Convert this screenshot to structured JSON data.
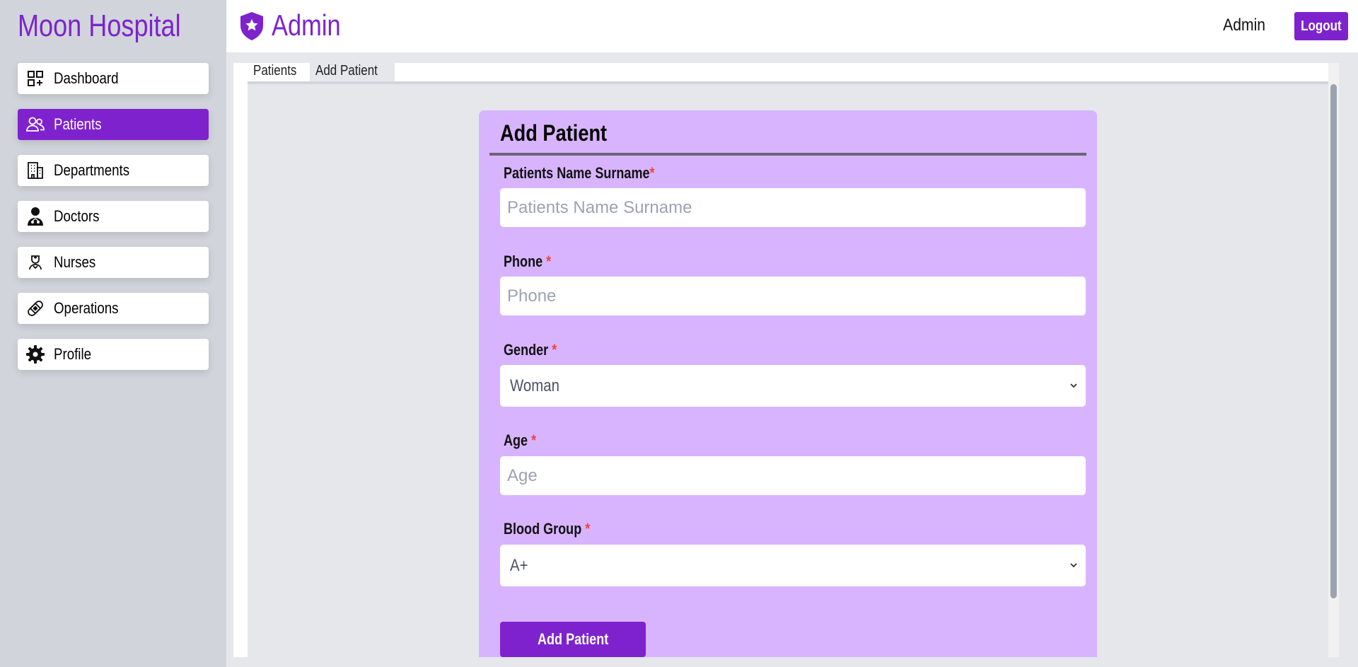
{
  "brand": "Moon Hospital",
  "header": {
    "title": "Admin",
    "user": "Admin",
    "logout_label": "Logout"
  },
  "sidebar": {
    "items": [
      {
        "label": "Dashboard",
        "icon": "dashboard-icon",
        "active": false
      },
      {
        "label": "Patients",
        "icon": "patients-icon",
        "active": true
      },
      {
        "label": "Departments",
        "icon": "building-icon",
        "active": false
      },
      {
        "label": "Doctors",
        "icon": "doctor-icon",
        "active": false
      },
      {
        "label": "Nurses",
        "icon": "nurse-icon",
        "active": false
      },
      {
        "label": "Operations",
        "icon": "bandage-icon",
        "active": false
      },
      {
        "label": "Profile",
        "icon": "gear-icon",
        "active": false
      }
    ]
  },
  "tabs": [
    {
      "label": "Patients",
      "active": false
    },
    {
      "label": "Add Patient",
      "active": true
    }
  ],
  "form": {
    "title": "Add Patient",
    "required_mark": "*",
    "fields": {
      "name": {
        "label": "Patients Name Surname",
        "placeholder": "Patients Name Surname"
      },
      "phone": {
        "label": "Phone",
        "placeholder": "Phone"
      },
      "gender": {
        "label": "Gender",
        "value": "Woman"
      },
      "age": {
        "label": "Age",
        "placeholder": "Age"
      },
      "blood": {
        "label": "Blood Group",
        "value": "A+"
      }
    },
    "submit_label": "Add Patient"
  },
  "colors": {
    "accent": "#7e22ce",
    "card": "#d8b4fe",
    "required": "#ef4444",
    "sidebar_bg": "#d1d5db"
  }
}
